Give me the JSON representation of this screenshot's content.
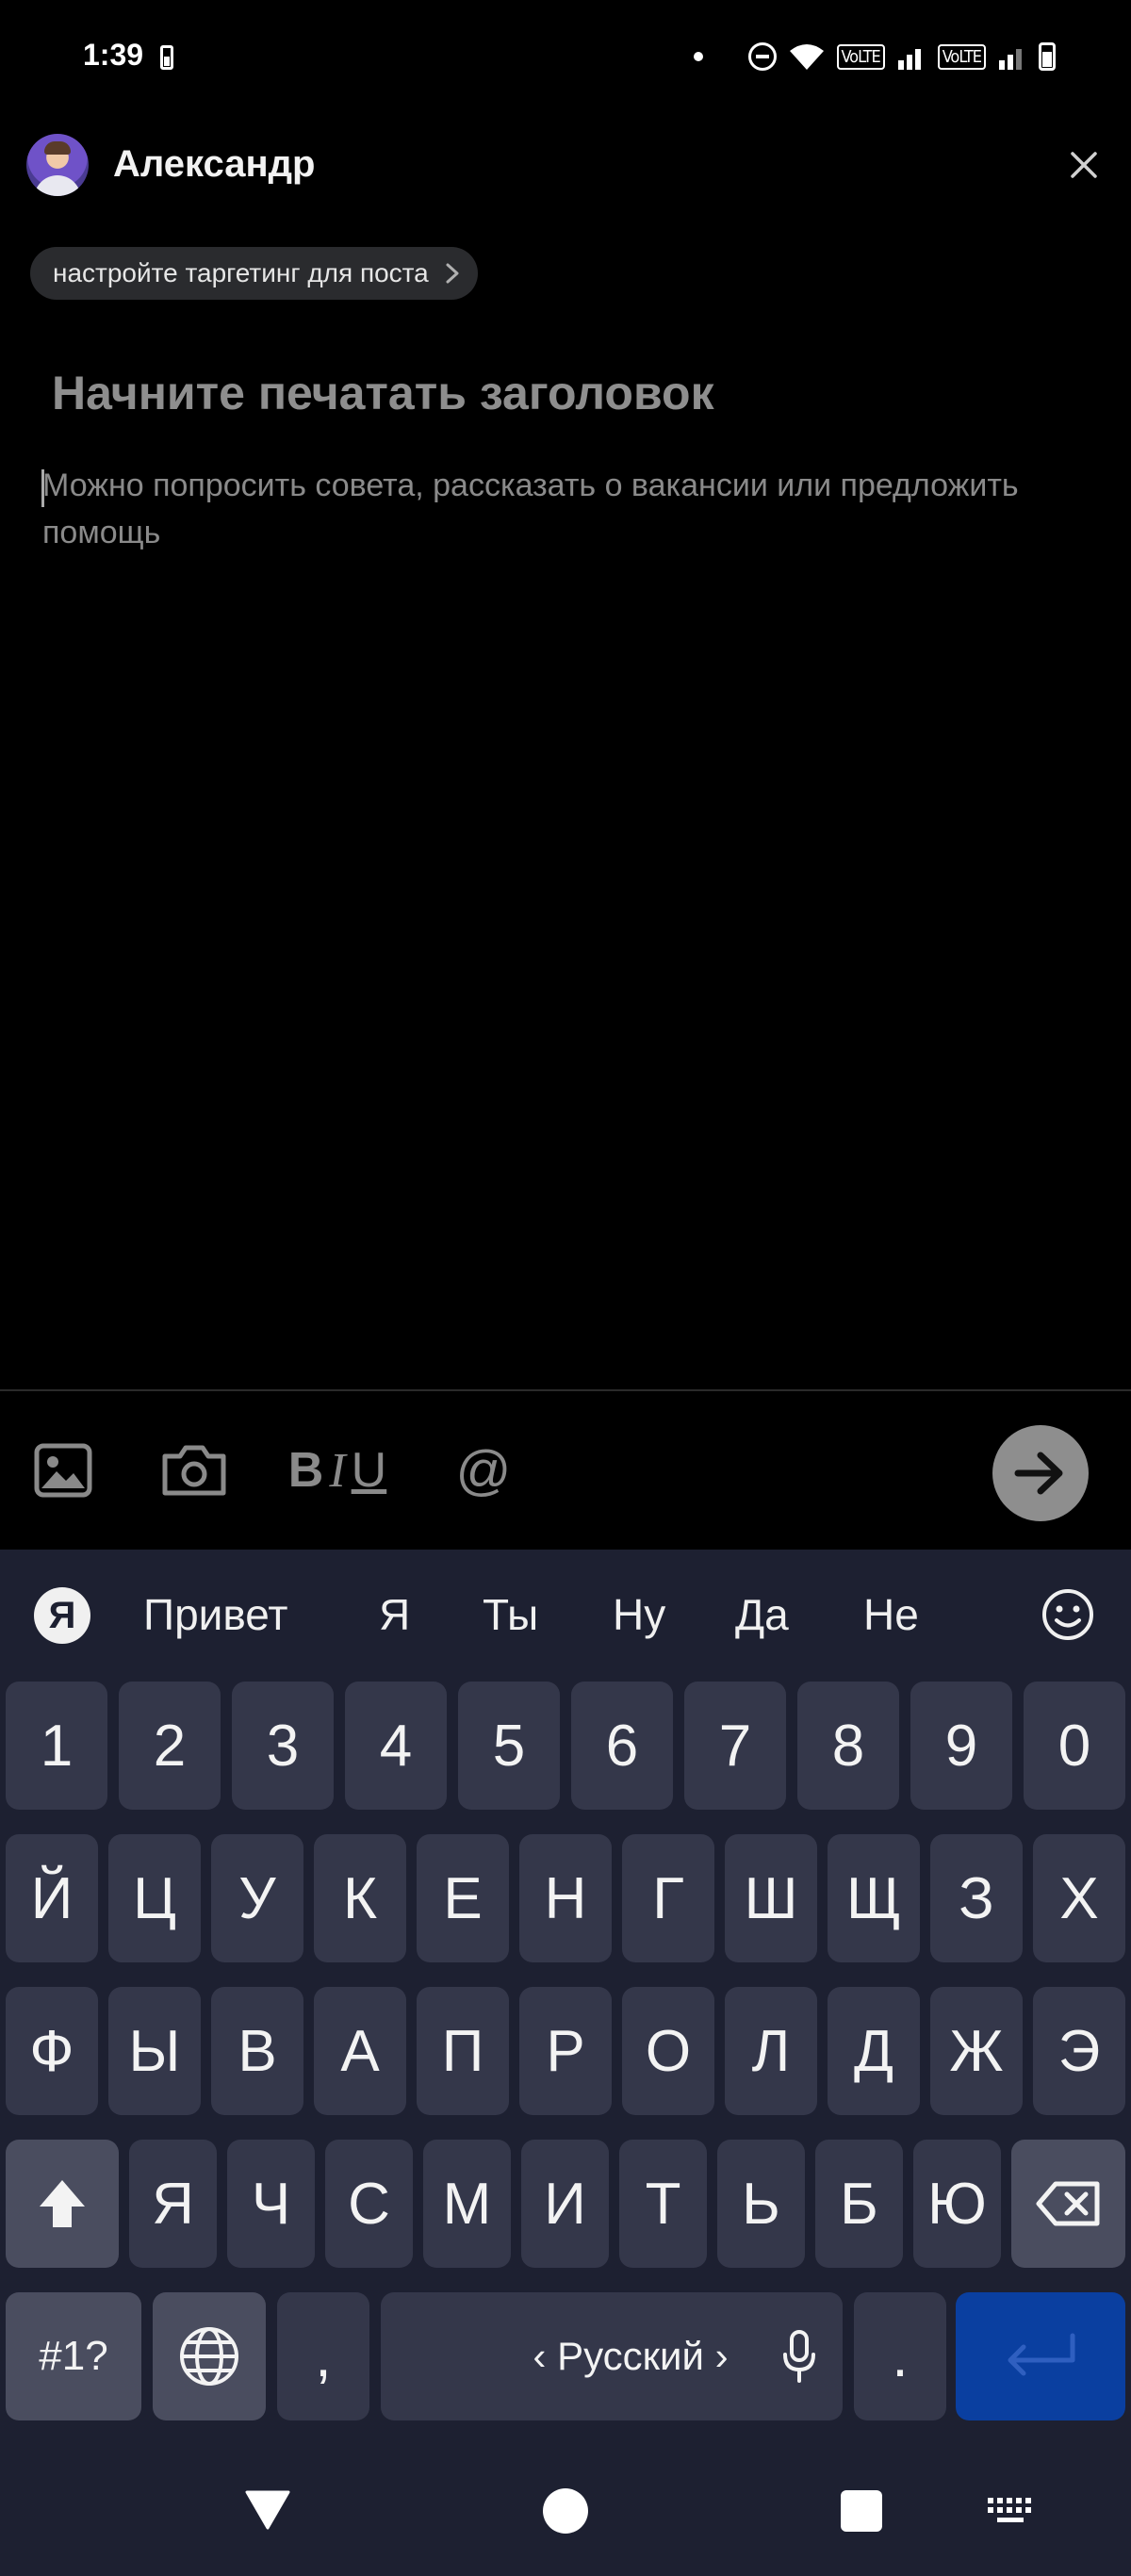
{
  "status_bar": {
    "time": "1:39",
    "volte_1": "VoLTE",
    "volte_2": "VoLTE"
  },
  "header": {
    "user_name": "Александр"
  },
  "targeting": {
    "label": "настройте таргетинг для поста"
  },
  "editor": {
    "title_placeholder": "Начните печатать заголовок",
    "body_placeholder": "Можно попросить совета, рассказать о вакансии или предложить помощь"
  },
  "toolbar": {
    "bold": "B",
    "italic": "I",
    "underline": "U",
    "mention": "@"
  },
  "keyboard": {
    "logo": "Я",
    "suggestions": [
      "Привет",
      "Я",
      "Ты",
      "Ну",
      "Да",
      "Не"
    ],
    "row_numbers": [
      "1",
      "2",
      "3",
      "4",
      "5",
      "6",
      "7",
      "8",
      "9",
      "0"
    ],
    "row_1": [
      "Й",
      "Ц",
      "У",
      "К",
      "Е",
      "Н",
      "Г",
      "Ш",
      "Щ",
      "З",
      "Х"
    ],
    "row_2": [
      "Ф",
      "Ы",
      "В",
      "А",
      "П",
      "Р",
      "О",
      "Л",
      "Д",
      "Ж",
      "Э"
    ],
    "row_3": [
      "Я",
      "Ч",
      "С",
      "М",
      "И",
      "Т",
      "Ь",
      "Б",
      "Ю"
    ],
    "symbols_key": "#1?",
    "comma_key": ",",
    "space_key": "‹ Русский ›",
    "period_key": "."
  },
  "colors": {
    "keyboard_bg": "#1d2031",
    "key_bg": "#34374a",
    "enter_key": "#0a3fa0",
    "send_button": "#8e8e8e"
  }
}
